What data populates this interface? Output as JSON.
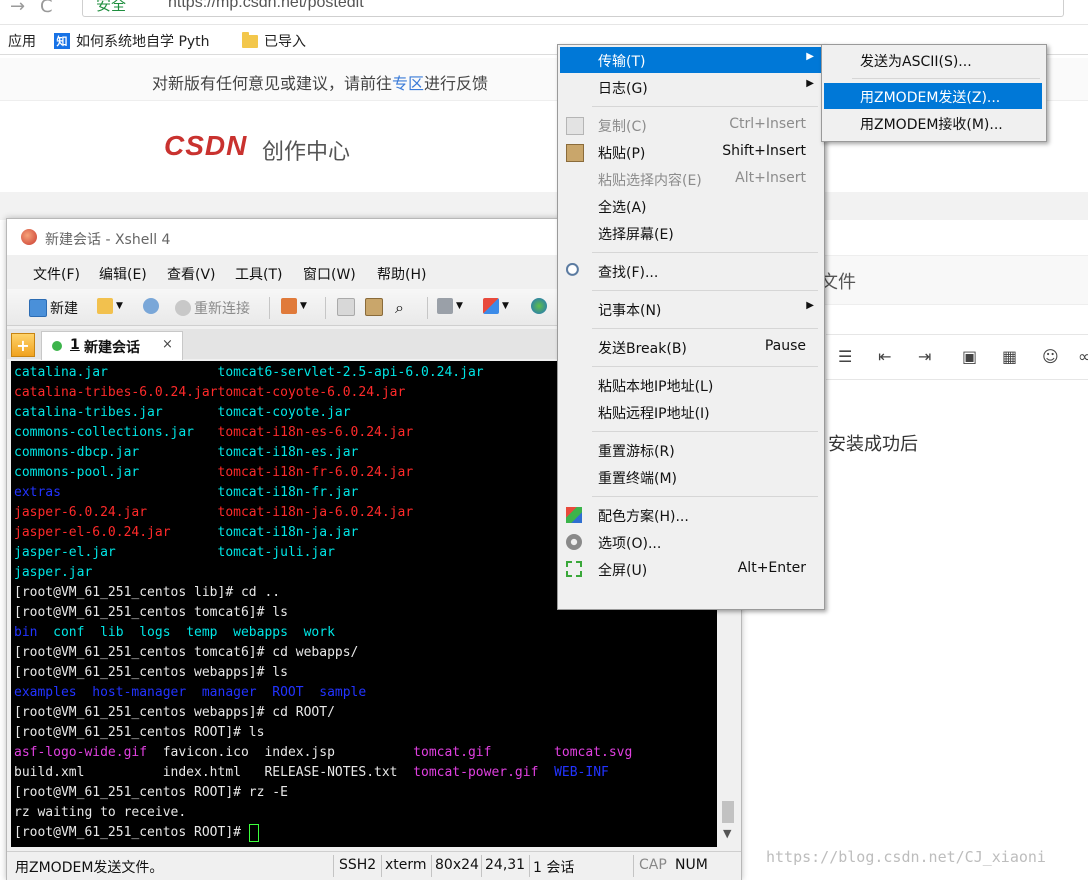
{
  "browser": {
    "secure_label": "安全",
    "url": "https://mp.csdn.net/postedit",
    "bookmarks": [
      {
        "label": "应用"
      },
      {
        "label": "如何系统地自学 Pyth"
      },
      {
        "label": "已导入"
      }
    ],
    "zhihu_glyph": "知"
  },
  "page": {
    "feedback_prefix": "对新版有任何意见或建议，请前往",
    "feedback_link": "专区",
    "feedback_suffix": "进行反馈",
    "logo": "CSDN",
    "logo_sub": "创作中心",
    "partial_heading": "文件",
    "editor_text": "安装成功后",
    "watermark": "https://blog.csdn.net/CJ_xiaoni"
  },
  "xshell": {
    "title": "新建会话 - Xshell 4",
    "menu": [
      "文件(F)",
      "编辑(E)",
      "查看(V)",
      "工具(T)",
      "窗口(W)",
      "帮助(H)"
    ],
    "toolbar": {
      "new": "新建",
      "reconnect": "重新连接"
    },
    "tab": {
      "number": "1",
      "label": "新建会话",
      "close": "×"
    },
    "terminal_lines": [
      [
        {
          "t": "catalina.jar              ",
          "c": "#00e5e5"
        },
        {
          "t": "tomcat6-servlet-2.5-api-6.0.24.jar",
          "c": "#00e5e5"
        }
      ],
      [
        {
          "t": "catalina-tribes-6.0.24.jar",
          "c": "#ff2a2a"
        },
        {
          "t": "tomcat-coyote-6.0.24.jar",
          "c": "#ff2a2a"
        }
      ],
      [
        {
          "t": "catalina-tribes.jar       ",
          "c": "#00e5e5"
        },
        {
          "t": "tomcat-coyote.jar",
          "c": "#00e5e5"
        }
      ],
      [
        {
          "t": "commons-collections.jar   ",
          "c": "#00e5e5"
        },
        {
          "t": "tomcat-i18n-es-6.0.24.jar",
          "c": "#ff2a2a"
        }
      ],
      [
        {
          "t": "commons-dbcp.jar          ",
          "c": "#00e5e5"
        },
        {
          "t": "tomcat-i18n-es.jar",
          "c": "#00e5e5"
        }
      ],
      [
        {
          "t": "commons-pool.jar          ",
          "c": "#00e5e5"
        },
        {
          "t": "tomcat-i18n-fr-6.0.24.jar",
          "c": "#ff2a2a"
        }
      ],
      [
        {
          "t": "extras                    ",
          "c": "#2233ff"
        },
        {
          "t": "tomcat-i18n-fr.jar",
          "c": "#00e5e5"
        }
      ],
      [
        {
          "t": "jasper-6.0.24.jar         ",
          "c": "#ff2a2a"
        },
        {
          "t": "tomcat-i18n-ja-6.0.24.jar",
          "c": "#ff2a2a"
        }
      ],
      [
        {
          "t": "jasper-el-6.0.24.jar      ",
          "c": "#ff2a2a"
        },
        {
          "t": "tomcat-i18n-ja.jar",
          "c": "#00e5e5"
        }
      ],
      [
        {
          "t": "jasper-el.jar             ",
          "c": "#00e5e5"
        },
        {
          "t": "tomcat-juli.jar",
          "c": "#00e5e5"
        }
      ],
      [
        {
          "t": "jasper.jar",
          "c": "#00e5e5"
        }
      ],
      [
        {
          "t": "[root@VM_61_251_centos lib]# cd ..",
          "c": "#e8e8e8"
        }
      ],
      [
        {
          "t": "[root@VM_61_251_centos tomcat6]# ls",
          "c": "#e8e8e8"
        }
      ],
      [
        {
          "t": "bin  ",
          "c": "#2233ff"
        },
        {
          "t": "conf  lib  logs  temp  webapps  work",
          "c": "#00e5e5"
        }
      ],
      [
        {
          "t": "[root@VM_61_251_centos tomcat6]# cd webapps/",
          "c": "#e8e8e8"
        }
      ],
      [
        {
          "t": "[root@VM_61_251_centos webapps]# ls",
          "c": "#e8e8e8"
        }
      ],
      [
        {
          "t": "examples  host-manager  manager  ROOT  sample",
          "c": "#2233ff"
        }
      ],
      [
        {
          "t": "[root@VM_61_251_centos webapps]# cd ROOT/",
          "c": "#e8e8e8"
        }
      ],
      [
        {
          "t": "[root@VM_61_251_centos ROOT]# ls",
          "c": "#e8e8e8"
        }
      ],
      [
        {
          "t": "asf-logo-wide.gif  ",
          "c": "#e040e0"
        },
        {
          "t": "favicon.ico  index.jsp          ",
          "c": "#e8e8e8"
        },
        {
          "t": "tomcat.gif        tomcat.svg",
          "c": "#e040e0"
        }
      ],
      [
        {
          "t": "build.xml          index.html   RELEASE-NOTES.txt  ",
          "c": "#e8e8e8"
        },
        {
          "t": "tomcat-power.gif  ",
          "c": "#e040e0"
        },
        {
          "t": "WEB-INF",
          "c": "#2233ff"
        }
      ],
      [
        {
          "t": "[root@VM_61_251_centos ROOT]# rz -E",
          "c": "#e8e8e8"
        }
      ],
      [
        {
          "t": "rz waiting to receive.",
          "c": "#e8e8e8"
        }
      ],
      [
        {
          "t": "[root@VM_61_251_centos ROOT]# ",
          "c": "#e8e8e8"
        }
      ]
    ],
    "status": {
      "message": "用ZMODEM发送文件。",
      "protocol": "SSH2",
      "term": "xterm",
      "size": "80x24",
      "cursor": "24,31",
      "sessions": "1 会话",
      "cap": "CAP",
      "num": "NUM"
    }
  },
  "context_menu": {
    "items": [
      {
        "label": "传输(T)",
        "shortcut": "",
        "submenu": true,
        "highlight": true,
        "disabled": false,
        "icon": "transfer-icon"
      },
      {
        "label": "日志(G)",
        "shortcut": "",
        "submenu": true,
        "highlight": false,
        "disabled": false,
        "icon": "log-icon"
      },
      {
        "label": "复制(C)",
        "shortcut": "Ctrl+Insert",
        "submenu": false,
        "highlight": false,
        "disabled": true,
        "icon": "copy-icon"
      },
      {
        "label": "粘贴(P)",
        "shortcut": "Shift+Insert",
        "submenu": false,
        "highlight": false,
        "disabled": false,
        "icon": "paste-icon"
      },
      {
        "label": "粘贴选择内容(E)",
        "shortcut": "Alt+Insert",
        "submenu": false,
        "highlight": false,
        "disabled": true,
        "icon": "paste-selection-icon"
      },
      {
        "label": "全选(A)",
        "shortcut": "",
        "submenu": false,
        "highlight": false,
        "disabled": false,
        "icon": "select-all-icon"
      },
      {
        "label": "选择屏幕(E)",
        "shortcut": "",
        "submenu": false,
        "highlight": false,
        "disabled": false,
        "icon": "select-screen-icon"
      },
      {
        "label": "查找(F)...",
        "shortcut": "",
        "submenu": false,
        "highlight": false,
        "disabled": false,
        "icon": "search-icon"
      },
      {
        "label": "记事本(N)",
        "shortcut": "",
        "submenu": true,
        "highlight": false,
        "disabled": false,
        "icon": "notepad-icon"
      },
      {
        "label": "发送Break(B)",
        "shortcut": "Pause",
        "submenu": false,
        "highlight": false,
        "disabled": false,
        "icon": "break-icon"
      },
      {
        "label": "粘贴本地IP地址(L)",
        "shortcut": "",
        "submenu": false,
        "highlight": false,
        "disabled": false,
        "icon": "local-ip-icon"
      },
      {
        "label": "粘贴远程IP地址(I)",
        "shortcut": "",
        "submenu": false,
        "highlight": false,
        "disabled": false,
        "icon": "remote-ip-icon"
      },
      {
        "label": "重置游标(R)",
        "shortcut": "",
        "submenu": false,
        "highlight": false,
        "disabled": false,
        "icon": "reset-cursor-icon"
      },
      {
        "label": "重置终端(M)",
        "shortcut": "",
        "submenu": false,
        "highlight": false,
        "disabled": false,
        "icon": "reset-terminal-icon"
      },
      {
        "label": "配色方案(H)...",
        "shortcut": "",
        "submenu": false,
        "highlight": false,
        "disabled": false,
        "icon": "color-scheme-icon"
      },
      {
        "label": "选项(O)...",
        "shortcut": "",
        "submenu": false,
        "highlight": false,
        "disabled": false,
        "icon": "options-gear-icon"
      },
      {
        "label": "全屏(U)",
        "shortcut": "Alt+Enter",
        "submenu": false,
        "highlight": false,
        "disabled": false,
        "icon": "fullscreen-icon"
      }
    ]
  },
  "submenu": {
    "items": [
      {
        "label": "发送为ASCII(S)...",
        "highlight": false
      },
      {
        "label": "用ZMODEM发送(Z)...",
        "highlight": true
      },
      {
        "label": "用ZMODEM接收(M)...",
        "highlight": false
      }
    ]
  }
}
